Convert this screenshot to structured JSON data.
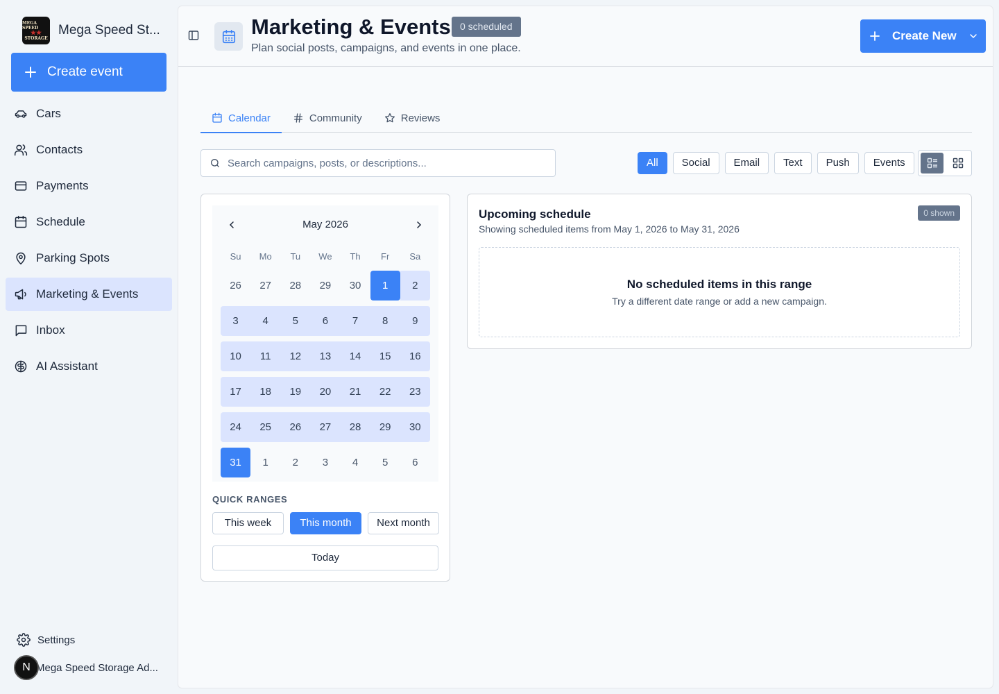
{
  "app": {
    "brand_name": "Mega Speed St...",
    "logo_text": [
      "MEGA SPEED",
      "★★",
      "STORAGE"
    ]
  },
  "sidebar": {
    "create_event_label": "Create event",
    "items": [
      {
        "label": "Cars",
        "icon": "car-icon",
        "active": false
      },
      {
        "label": "Contacts",
        "icon": "users-icon",
        "active": false
      },
      {
        "label": "Payments",
        "icon": "credit-card-icon",
        "active": false
      },
      {
        "label": "Schedule",
        "icon": "calendar-icon",
        "active": false
      },
      {
        "label": "Parking Spots",
        "icon": "map-pin-icon",
        "active": false
      },
      {
        "label": "Marketing & Events",
        "icon": "megaphone-icon",
        "active": true
      },
      {
        "label": "Inbox",
        "icon": "message-square-icon",
        "active": false
      },
      {
        "label": "AI Assistant",
        "icon": "brain-icon",
        "active": false
      }
    ],
    "settings_label": "Settings",
    "account_initial": "N",
    "account_name": "Mega Speed Storage Ad..."
  },
  "header": {
    "title": "Marketing & Events",
    "badge": "0 scheduled",
    "subtitle": "Plan social posts, campaigns, and events in one place.",
    "create_new_label": "Create New"
  },
  "tabs": [
    {
      "label": "Calendar",
      "icon": "calendar-icon",
      "active": true
    },
    {
      "label": "Community",
      "icon": "hash-icon",
      "active": false
    },
    {
      "label": "Reviews",
      "icon": "star-icon",
      "active": false
    }
  ],
  "search": {
    "placeholder": "Search campaigns, posts, or descriptions...",
    "value": ""
  },
  "filters": [
    {
      "label": "All",
      "active": true
    },
    {
      "label": "Social",
      "active": false
    },
    {
      "label": "Email",
      "active": false
    },
    {
      "label": "Text",
      "active": false
    },
    {
      "label": "Push",
      "active": false
    },
    {
      "label": "Events",
      "active": false
    }
  ],
  "view_modes": [
    {
      "icon": "list-icon",
      "active": true
    },
    {
      "icon": "grid-icon",
      "active": false
    }
  ],
  "calendar": {
    "month_label": "May 2026",
    "weekdays": [
      "Su",
      "Mo",
      "Tu",
      "We",
      "Th",
      "Fr",
      "Sa"
    ],
    "weeks": [
      [
        {
          "d": "26",
          "out": true
        },
        {
          "d": "27",
          "out": true
        },
        {
          "d": "28",
          "out": true
        },
        {
          "d": "29",
          "out": true
        },
        {
          "d": "30",
          "out": true
        },
        {
          "d": "1",
          "state": "selected"
        },
        {
          "d": "2",
          "state": "range"
        }
      ],
      [
        {
          "d": "3",
          "state": "range"
        },
        {
          "d": "4",
          "state": "range"
        },
        {
          "d": "5",
          "state": "range"
        },
        {
          "d": "6",
          "state": "range"
        },
        {
          "d": "7",
          "state": "range"
        },
        {
          "d": "8",
          "state": "range"
        },
        {
          "d": "9",
          "state": "range"
        }
      ],
      [
        {
          "d": "10",
          "state": "range"
        },
        {
          "d": "11",
          "state": "range"
        },
        {
          "d": "12",
          "state": "range"
        },
        {
          "d": "13",
          "state": "range"
        },
        {
          "d": "14",
          "state": "range"
        },
        {
          "d": "15",
          "state": "range"
        },
        {
          "d": "16",
          "state": "range"
        }
      ],
      [
        {
          "d": "17",
          "state": "range"
        },
        {
          "d": "18",
          "state": "range"
        },
        {
          "d": "19",
          "state": "range"
        },
        {
          "d": "20",
          "state": "range"
        },
        {
          "d": "21",
          "state": "range"
        },
        {
          "d": "22",
          "state": "range"
        },
        {
          "d": "23",
          "state": "range"
        }
      ],
      [
        {
          "d": "24",
          "state": "range"
        },
        {
          "d": "25",
          "state": "range"
        },
        {
          "d": "26",
          "state": "range"
        },
        {
          "d": "27",
          "state": "range"
        },
        {
          "d": "28",
          "state": "range"
        },
        {
          "d": "29",
          "state": "range"
        },
        {
          "d": "30",
          "state": "range"
        }
      ],
      [
        {
          "d": "31",
          "state": "selected"
        },
        {
          "d": "1",
          "out": true
        },
        {
          "d": "2",
          "out": true
        },
        {
          "d": "3",
          "out": true
        },
        {
          "d": "4",
          "out": true
        },
        {
          "d": "5",
          "out": true
        },
        {
          "d": "6",
          "out": true
        }
      ]
    ],
    "quick_ranges_label": "QUICK RANGES",
    "quick_ranges": [
      {
        "label": "This week",
        "active": false
      },
      {
        "label": "This month",
        "active": true
      },
      {
        "label": "Next month",
        "active": false
      }
    ],
    "today_label": "Today"
  },
  "upcoming": {
    "title": "Upcoming schedule",
    "subtitle": "Showing scheduled items from May 1, 2026 to May 31, 2026",
    "badge": "0 shown",
    "empty_title": "No scheduled items in this range",
    "empty_subtitle": "Try a different date range or add a new campaign."
  },
  "colors": {
    "accent": "#3b82f6",
    "range": "#dbe4fe",
    "badge": "#64748b"
  }
}
